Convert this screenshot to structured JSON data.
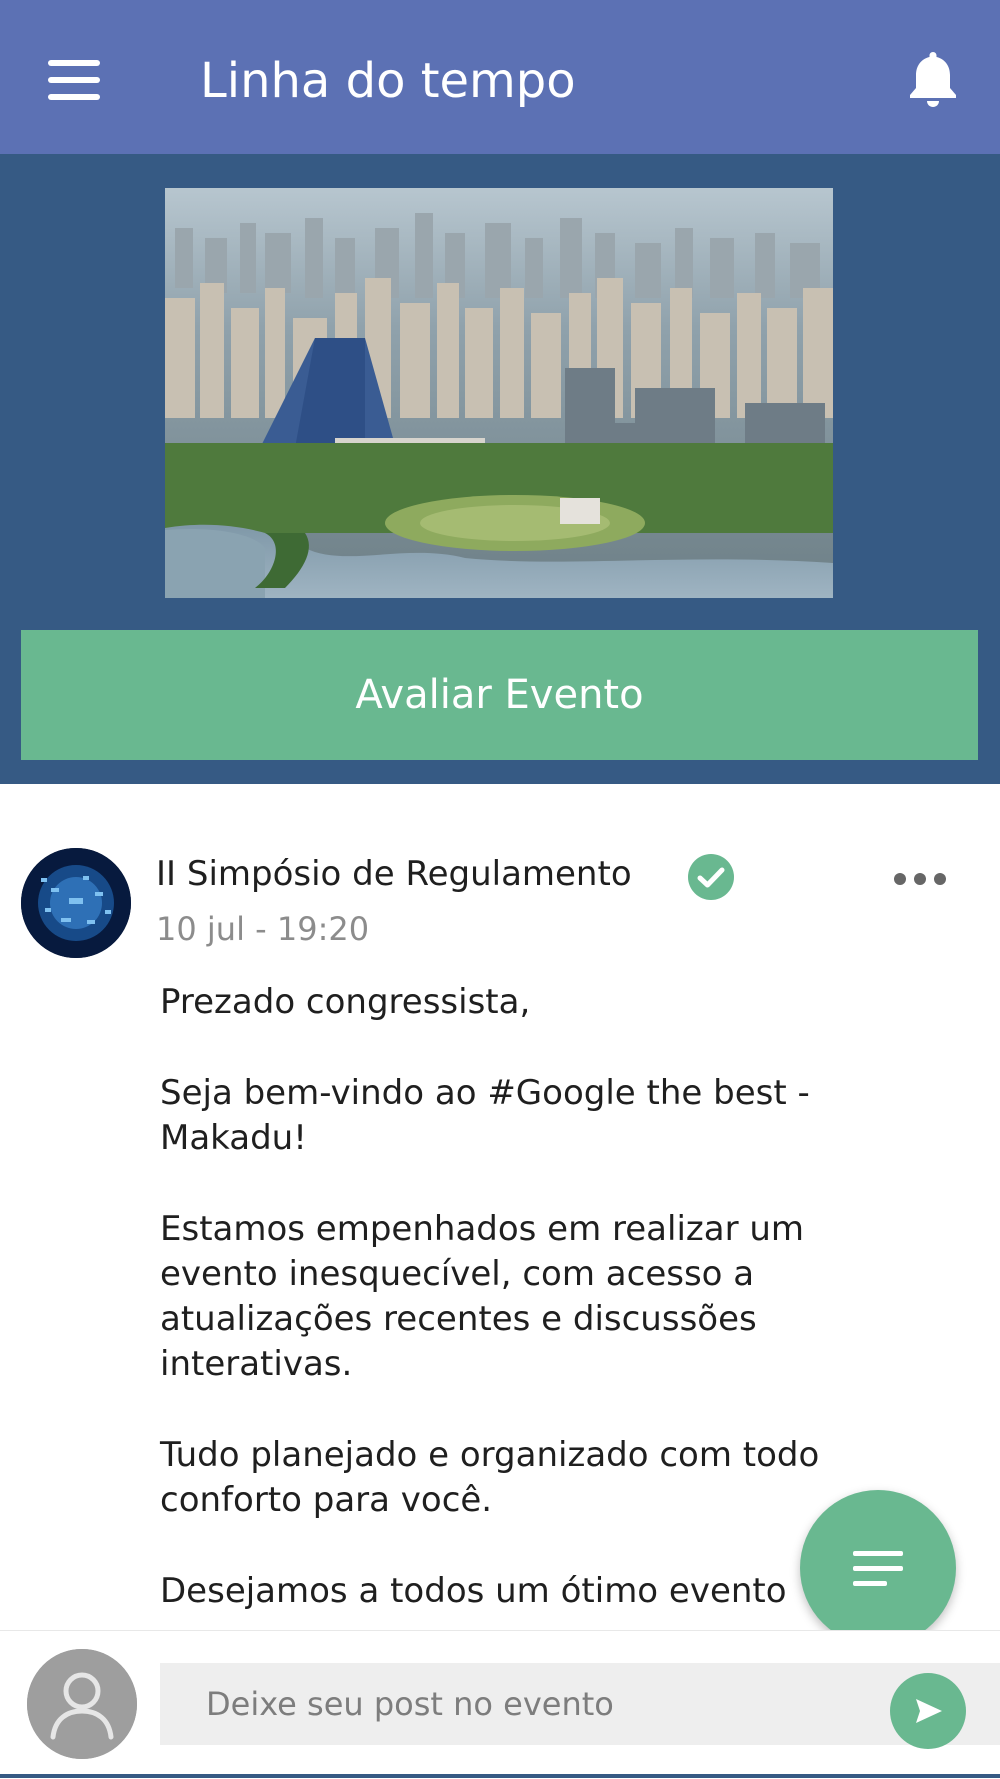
{
  "appbar": {
    "title": "Linha do tempo",
    "menu_icon": "hamburger-menu-icon",
    "notification_icon": "bell-icon"
  },
  "hero": {
    "image_subject": "aerial city skyline",
    "rate_button_label": "Avaliar Evento"
  },
  "post": {
    "author": "II Simpósio de Regulamento",
    "verified_icon": "verified-check-icon",
    "date": "10 jul - 19:20",
    "more_icon": "more-dots-icon",
    "body": {
      "p1": "Prezado congressista,",
      "p2": "Seja bem-vindo ao #Google the best - Makadu!",
      "p3": "Estamos empenhados em realizar um evento inesquecível, com acesso a atualizações recentes e discussões interativas.",
      "p4": "Tudo planejado e organizado com todo conforto para você.",
      "p5": "Desejamos a todos um ótimo evento"
    }
  },
  "fab": {
    "icon": "menu-lines-icon"
  },
  "composer": {
    "placeholder": "Deixe seu post no evento",
    "value": "",
    "avatar_icon": "user-silhouette-icon",
    "send_icon": "send-arrow-icon"
  },
  "colors": {
    "appbar": "#5c71b4",
    "hero_background": "#365a84",
    "accent_green": "#69b890",
    "date_gray": "#8c8c8c"
  }
}
